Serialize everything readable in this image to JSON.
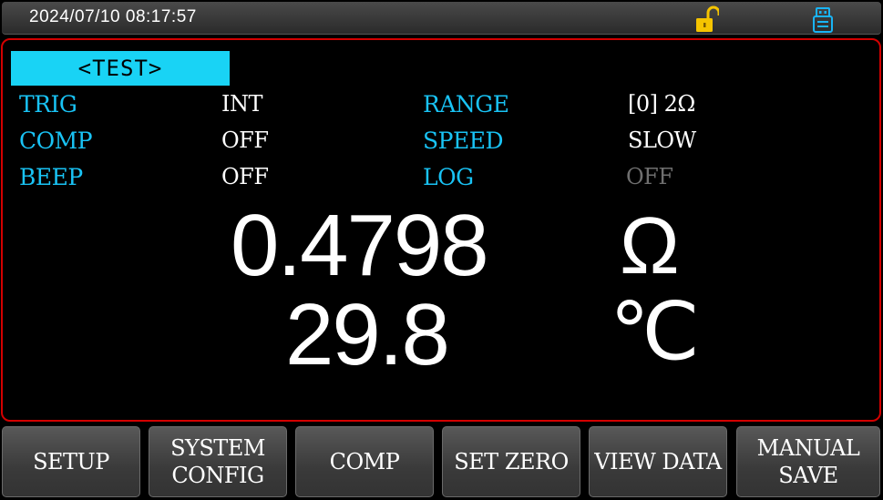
{
  "status_bar": {
    "datetime": "2024/07/10  08:17:57",
    "lock_icon": "lock-open-icon",
    "usb_icon": "usb-icon",
    "lock_color": "#f5c400",
    "usb_color": "#19b4f5"
  },
  "page": {
    "title": "<TEST>",
    "title_bg": "#19d3f5",
    "border_color": "#d40000"
  },
  "fields": {
    "trig": {
      "label": "TRIG",
      "value": "INT"
    },
    "comp": {
      "label": "COMP",
      "value": "OFF"
    },
    "beep": {
      "label": "BEEP",
      "value": "OFF"
    },
    "range": {
      "label": "RANGE",
      "value": "[0] 2Ω"
    },
    "speed": {
      "label": "SPEED",
      "value": "SLOW"
    },
    "log": {
      "label": "LOG",
      "value": "OFF"
    }
  },
  "measurement": {
    "resistance": "0.4798",
    "resistance_unit": "Ω",
    "temperature": "29.8",
    "temperature_unit": "℃"
  },
  "softkeys": [
    {
      "label": "SETUP"
    },
    {
      "label": "SYSTEM\nCONFIG"
    },
    {
      "label": "COMP"
    },
    {
      "label": "SET ZERO"
    },
    {
      "label": "VIEW DATA"
    },
    {
      "label": "MANUAL\nSAVE"
    }
  ],
  "colors": {
    "label": "#19c3f5",
    "value": "#ffffff",
    "dim_value": "#6f6f6f",
    "background": "#000000"
  }
}
